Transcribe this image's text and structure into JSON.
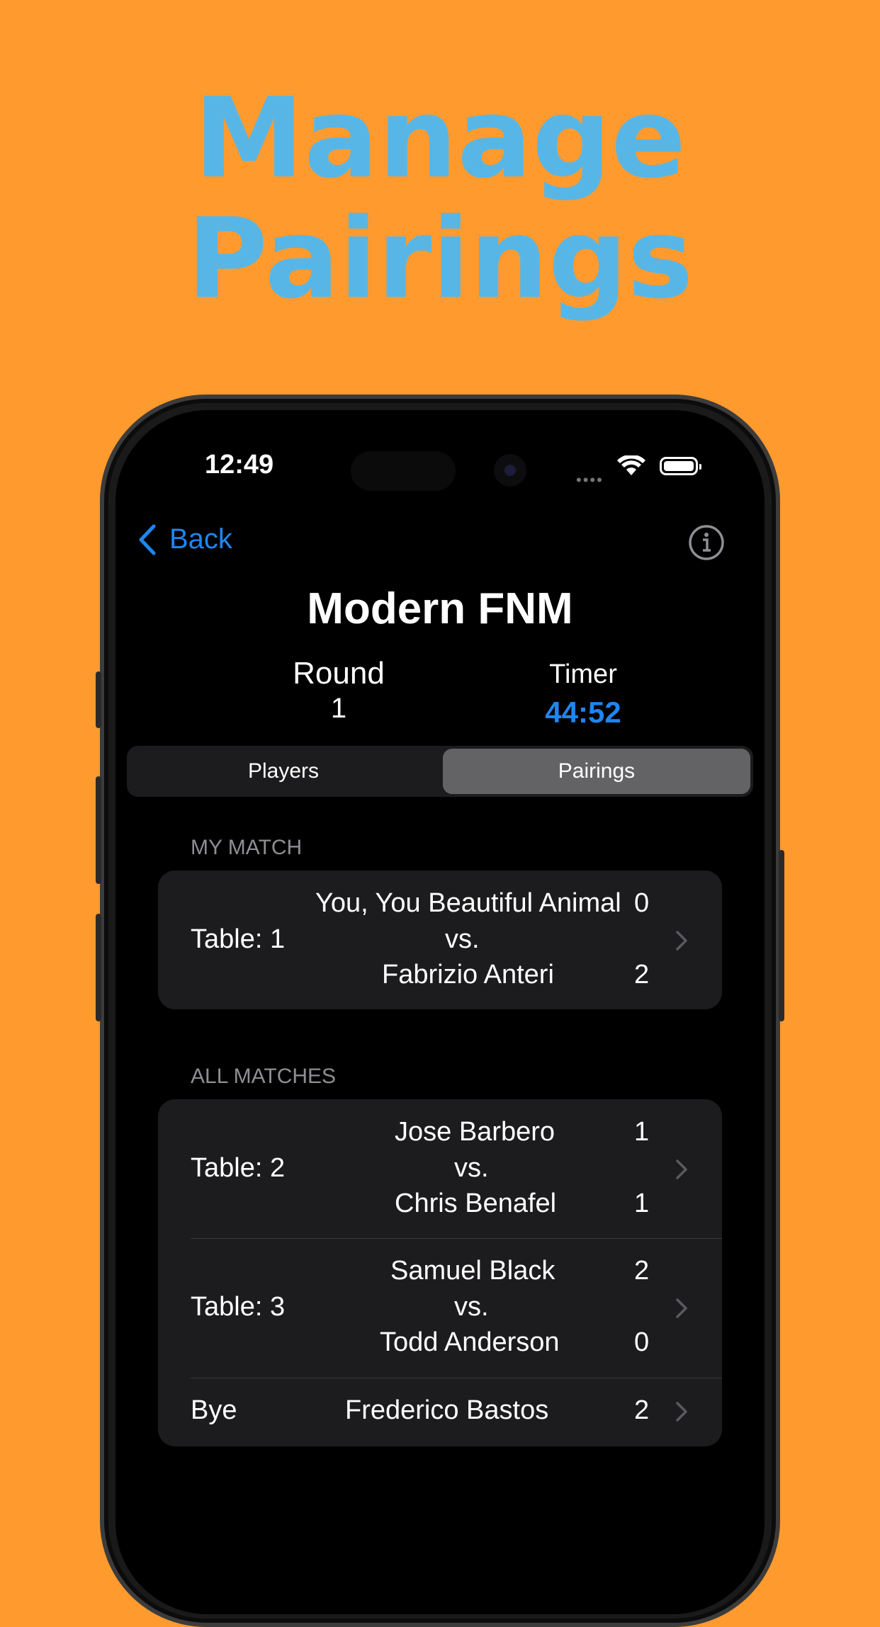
{
  "headline": {
    "line1": "Manage",
    "line2": "Pairings"
  },
  "status": {
    "time": "12:49"
  },
  "nav": {
    "back_label": "Back"
  },
  "event": {
    "title": "Modern FNM"
  },
  "round": {
    "label": "Round",
    "value": "1"
  },
  "timer": {
    "label": "Timer",
    "value": "44:52"
  },
  "tabs": [
    {
      "label": "Players",
      "selected": false
    },
    {
      "label": "Pairings",
      "selected": true
    }
  ],
  "my_match": {
    "header": "MY MATCH",
    "table": "Table: 1",
    "player1": "You, You Beautiful Animal",
    "score1": "0",
    "vs": "vs.",
    "player2": "Fabrizio Anteri",
    "score2": "2"
  },
  "all_matches": {
    "header": "ALL MATCHES",
    "rows": [
      {
        "table": "Table: 2",
        "player1": "Jose Barbero",
        "score1": "1",
        "vs": "vs.",
        "player2": "Chris Benafel",
        "score2": "1"
      },
      {
        "table": "Table: 3",
        "player1": "Samuel Black",
        "score1": "2",
        "vs": "vs.",
        "player2": "Todd Anderson",
        "score2": "0"
      }
    ],
    "bye": {
      "table": "Bye",
      "player": "Frederico Bastos",
      "score": "2"
    }
  },
  "colors": {
    "background": "#FF9A2E",
    "headline": "#58B6E6",
    "accent": "#1E86F0",
    "card": "#1C1C1E"
  }
}
